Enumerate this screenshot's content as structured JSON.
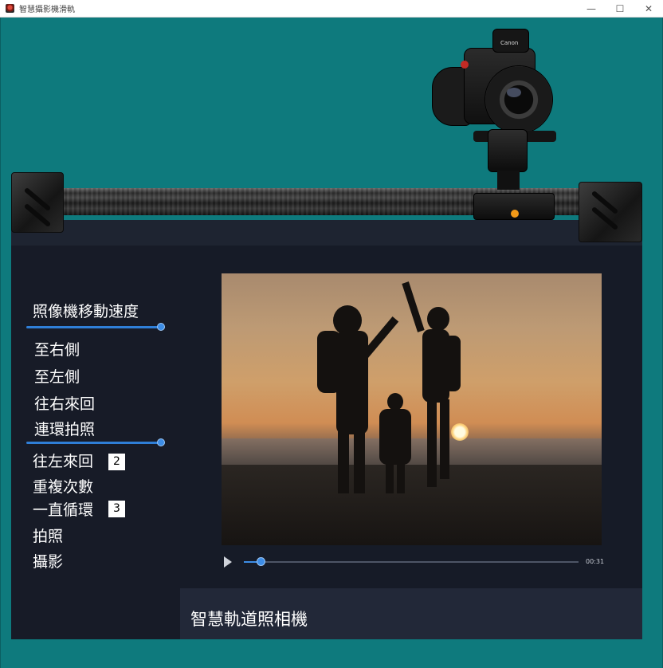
{
  "window": {
    "title": "智慧攝影機滑軌",
    "minimize_glyph": "—",
    "maximize_glyph": "☐",
    "close_glyph": "✕"
  },
  "controls": {
    "speed_label": "照像機移動速度",
    "to_right": "至右側",
    "to_left": "至左側",
    "right_roundtrip": "往右來回",
    "burst_photo": "連環拍照",
    "left_roundtrip": "往左來回",
    "left_roundtrip_value": "2",
    "repeat_count": "重複次數",
    "loop_forever": "一直循環",
    "loop_forever_value": "3",
    "take_photo": "拍照",
    "record_video": "攝影",
    "speed_slider_level": 1.0,
    "burst_slider_level": 1.0
  },
  "video": {
    "play_icon": "play-icon",
    "time": "00:31",
    "progress": 0.05
  },
  "camera": {
    "brand": "Canon"
  },
  "footer": {
    "title": "智慧軌道照相機"
  },
  "colors": {
    "background": "#0e7a7d",
    "panel": "#171b27",
    "accent": "#3d8de6",
    "carriage_knob": "#f39a18"
  }
}
